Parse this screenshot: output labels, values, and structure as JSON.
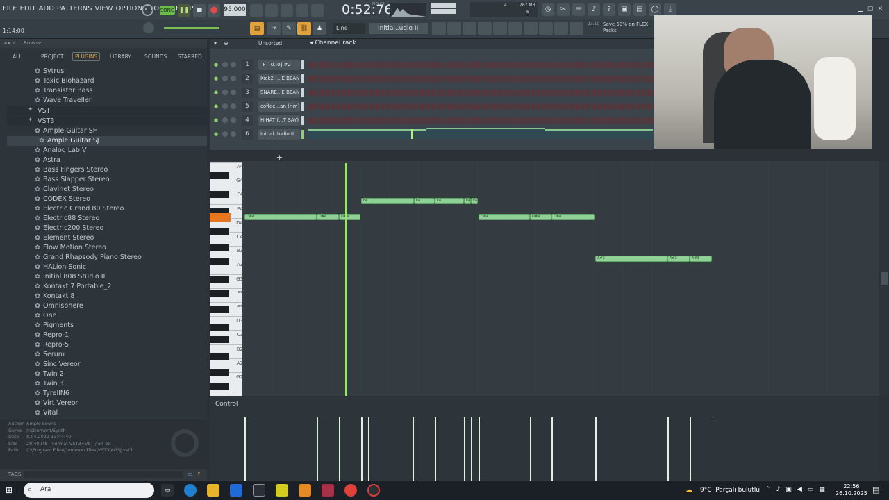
{
  "menu": [
    "FILE",
    "EDIT",
    "ADD",
    "PATTERNS",
    "VIEW",
    "OPTIONS",
    "TOOLS",
    "HELP"
  ],
  "transport": {
    "song_label": "SONG",
    "tempo": "95.000",
    "time": "0:52:76",
    "time_unit": "M:S:CS",
    "memory": "267 MB",
    "cpu_value": "4",
    "voices": "6"
  },
  "hint": {
    "position": "1:14:00"
  },
  "snap": {
    "mode": "Line",
    "pattern": "Initial..udio II"
  },
  "flex_banner": "Save 50% on FLEX Packs",
  "flex_num": "23.10",
  "browser": {
    "title": "Browser",
    "tabs": [
      "ALL",
      "PROJECT",
      "PLUGINS",
      "LIBRARY",
      "SOUNDS",
      "STARRED"
    ],
    "active_tab": "PLUGINS",
    "items": [
      "Sytrus",
      "Toxic Biohazard",
      "Transistor Bass",
      "Wave Traveller"
    ],
    "folders": [
      "VST",
      "VST3"
    ],
    "vst3_items": [
      "Ample Guitar SH",
      "Ample Guitar SJ",
      "Analog Lab V",
      "Astra",
      "Bass Fingers Stereo",
      "Bass Slapper Stereo",
      "Clavinet Stereo",
      "CODEX Stereo",
      "Electric Grand 80 Stereo",
      "Electric88 Stereo",
      "Electric200 Stereo",
      "Element Stereo",
      "Flow Motion Stereo",
      "Grand Rhapsody Piano Stereo",
      "HALion Sonic",
      "Initial 808 Studio II",
      "Kontakt 7 Portable_2",
      "Kontakt 8",
      "Omnisphere",
      "One",
      "Pigments",
      "Repro-1",
      "Repro-5",
      "Serum",
      "Sinc Vereor",
      "Twin 2",
      "Twin 3",
      "TyrellN6",
      "Virt Vereor",
      "Vital"
    ],
    "selected_item": "Ample Guitar SJ",
    "info": {
      "author_label": "Author",
      "author": "Ample Sound",
      "genre_label": "Genre",
      "genre": "Instrument/Synth",
      "date_label": "Date",
      "date": "8.04.2022 13:44:40",
      "size_label": "Size",
      "size": "28.40 MB",
      "format_label": "Format",
      "format": "VST3+VST / 64 bit",
      "path_label": "Path",
      "path": "C:\\Program Files\\Common Files\\VST3\\AGSJ.vst3"
    },
    "tags_label": "TAGS"
  },
  "channel_rack": {
    "title": "Channel rack",
    "filter": "Unsorted",
    "channels": [
      {
        "num": "1",
        "name": "_F__U..0] #2"
      },
      {
        "num": "2",
        "name": "Kick2 (...E BEAN)"
      },
      {
        "num": "3",
        "name": "SNARE...E BEAN)"
      },
      {
        "num": "5",
        "name": "coffee...an (rim)"
      },
      {
        "num": "4",
        "name": "HIHAT (...T SAY)"
      },
      {
        "num": "6",
        "name": "Initial..tudio II"
      }
    ]
  },
  "piano_roll": {
    "key_labels": [
      "A4",
      "G4",
      "F4",
      "E4",
      "D4",
      "C4",
      "B3",
      "A3",
      "G3",
      "F3",
      "E3",
      "D3",
      "C3",
      "B2",
      "A2",
      "G2"
    ],
    "notes_top": [
      {
        "label": "F4"
      },
      {
        "label": "F4"
      },
      {
        "label": "F4"
      },
      {
        "label": "F4"
      },
      {
        "label": "F4"
      }
    ],
    "notes_mid": [
      {
        "label": "D#4"
      },
      {
        "label": "D#4"
      },
      {
        "label": "D#4"
      },
      {
        "label": "D#4"
      },
      {
        "label": "D#4"
      },
      {
        "label": "D#4"
      }
    ],
    "notes_low": [
      {
        "label": "A#3"
      },
      {
        "label": "A#3"
      },
      {
        "label": "A#3"
      }
    ],
    "control_label": "Control"
  },
  "taskbar": {
    "search": "Ara",
    "weather_temp": "9°C",
    "weather_text": "Parçalı bulutlu",
    "clock_time": "22:56",
    "clock_date": "26.10.2025"
  }
}
